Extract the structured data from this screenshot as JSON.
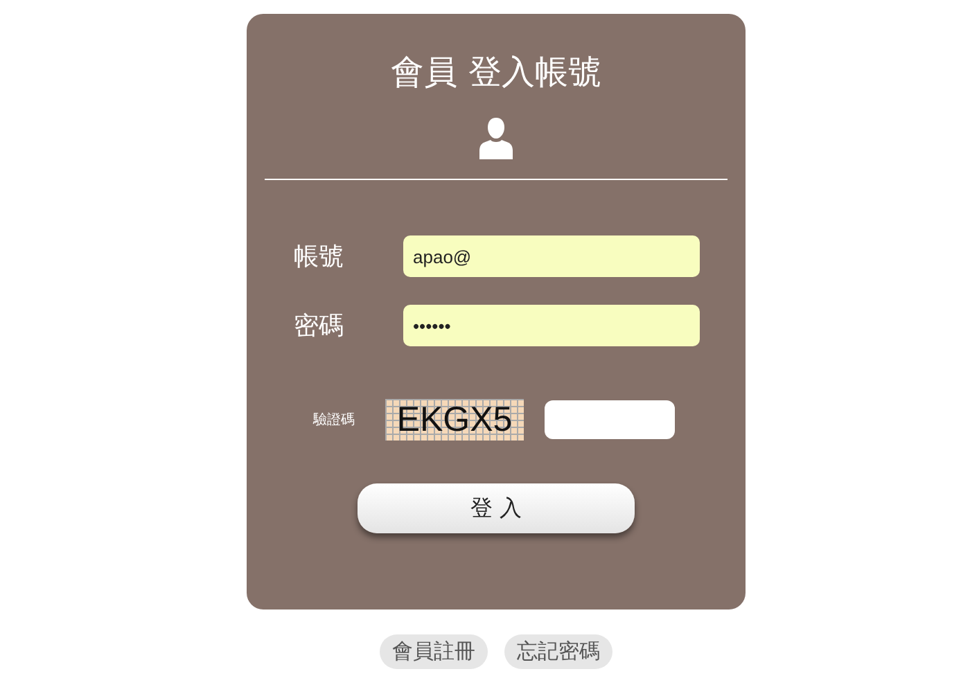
{
  "title": "會員 登入帳號",
  "fields": [
    {
      "label": "帳號",
      "value": "apao@"
    },
    {
      "label": "密碼",
      "value": "••••••"
    }
  ],
  "captcha": {
    "label": "驗證碼",
    "code": "EKGX5"
  },
  "submit": "登 入",
  "links": [
    "會員註冊",
    "忘記密碼"
  ]
}
